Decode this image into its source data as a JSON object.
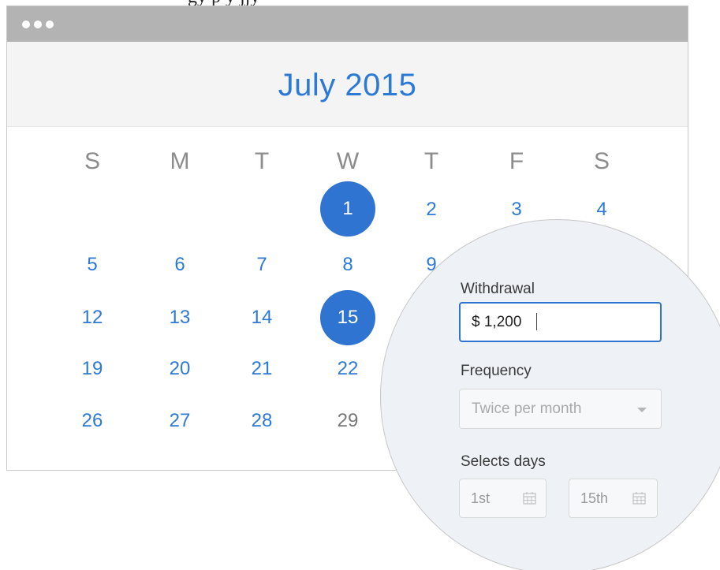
{
  "top_fragment": "gy p                                          y  jjy",
  "window": {
    "month_title": "July 2015"
  },
  "calendar": {
    "weekdays": [
      "S",
      "M",
      "T",
      "W",
      "T",
      "F",
      "S"
    ],
    "days": {
      "d1": "1",
      "d2": "2",
      "d3": "3",
      "d4": "4",
      "d5": "5",
      "d6": "6",
      "d7": "7",
      "d8": "8",
      "d9": "9",
      "d12": "12",
      "d13": "13",
      "d14": "14",
      "d15": "15",
      "d19": "19",
      "d20": "20",
      "d21": "21",
      "d22": "22",
      "d26": "26",
      "d27": "27",
      "d28": "28",
      "d29": "29"
    },
    "selected_days": [
      "1",
      "15"
    ]
  },
  "form": {
    "withdrawal_label": "Withdrawal",
    "withdrawal_value": "$ 1,200",
    "frequency_label": "Frequency",
    "frequency_value": "Twice per month",
    "selects_days_label": "Selects days",
    "day1_value": "1st",
    "day2_value": "15th"
  },
  "colors": {
    "accent": "#2e74d0",
    "day_text": "#2d7ad6",
    "titlebar": "#b3b3b3",
    "magnifier_bg": "#eef1f6"
  },
  "icons": [
    "calendar-icon",
    "chevron-down-icon"
  ]
}
